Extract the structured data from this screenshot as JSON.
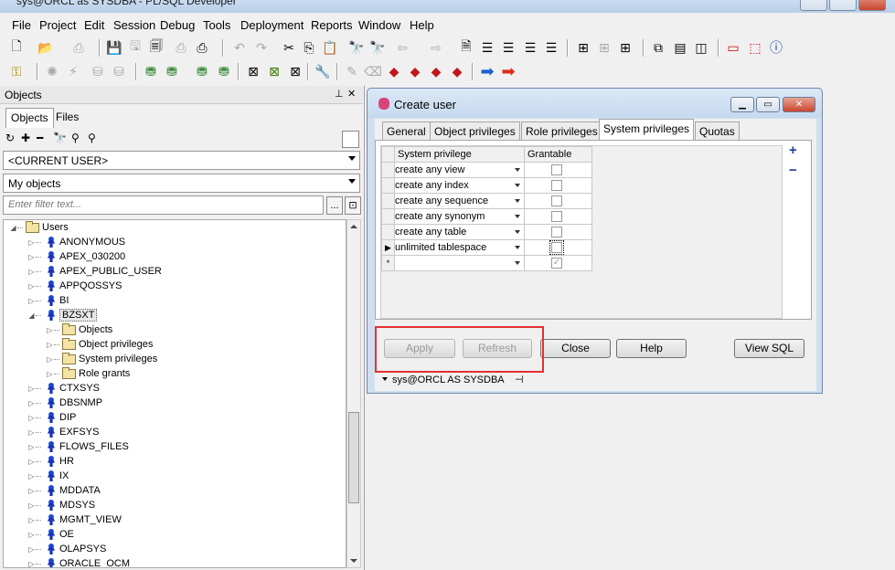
{
  "app": {
    "title": "sys@ORCL as SYSDBA - PL/SQL Developer"
  },
  "menu": [
    "File",
    "Project",
    "Edit",
    "Session",
    "Debug",
    "Tools",
    "Deployment",
    "Reports",
    "Window",
    "Help"
  ],
  "objects_pane": {
    "title": "Objects",
    "tabs": [
      "Objects",
      "Files"
    ],
    "user_select": "<CURRENT USER>",
    "objects_select": "My objects",
    "filter_placeholder": "Enter filter text...",
    "filter_btn": "...",
    "tree": {
      "root": "Users",
      "users_before": [
        "ANONYMOUS",
        "APEX_030200",
        "APEX_PUBLIC_USER",
        "APPQOSSYS",
        "BI"
      ],
      "expanded_user": "BZSXT",
      "expanded_children": [
        "Objects",
        "Object privileges",
        "System privileges",
        "Role grants"
      ],
      "users_after": [
        "CTXSYS",
        "DBSNMP",
        "DIP",
        "EXFSYS",
        "FLOWS_FILES",
        "HR",
        "IX",
        "MDDATA",
        "MDSYS",
        "MGMT_VIEW",
        "OE",
        "OLAPSYS",
        "ORACLE_OCM"
      ]
    }
  },
  "dialog": {
    "title": "Create user",
    "tabs": [
      "General",
      "Object privileges",
      "Role privileges",
      "System privileges",
      "Quotas"
    ],
    "active_tab": "System privileges",
    "grid": {
      "headers": [
        "System privilege",
        "Grantable"
      ],
      "rows": [
        {
          "privilege": "create any view",
          "grantable": false
        },
        {
          "privilege": "create any index",
          "grantable": false
        },
        {
          "privilege": "create any sequence",
          "grantable": false
        },
        {
          "privilege": "create any synonym",
          "grantable": false
        },
        {
          "privilege": "create any table",
          "grantable": false
        },
        {
          "privilege": "unlimited tablespace",
          "grantable": false
        }
      ],
      "new_row_marker": "*"
    },
    "add_icon": "+",
    "remove_icon": "−",
    "buttons": {
      "apply": "Apply",
      "refresh": "Refresh",
      "close": "Close",
      "help": "Help",
      "view_sql": "View SQL"
    },
    "status": "sys@ORCL AS SYSDBA",
    "highlight_color": "#e53030"
  }
}
